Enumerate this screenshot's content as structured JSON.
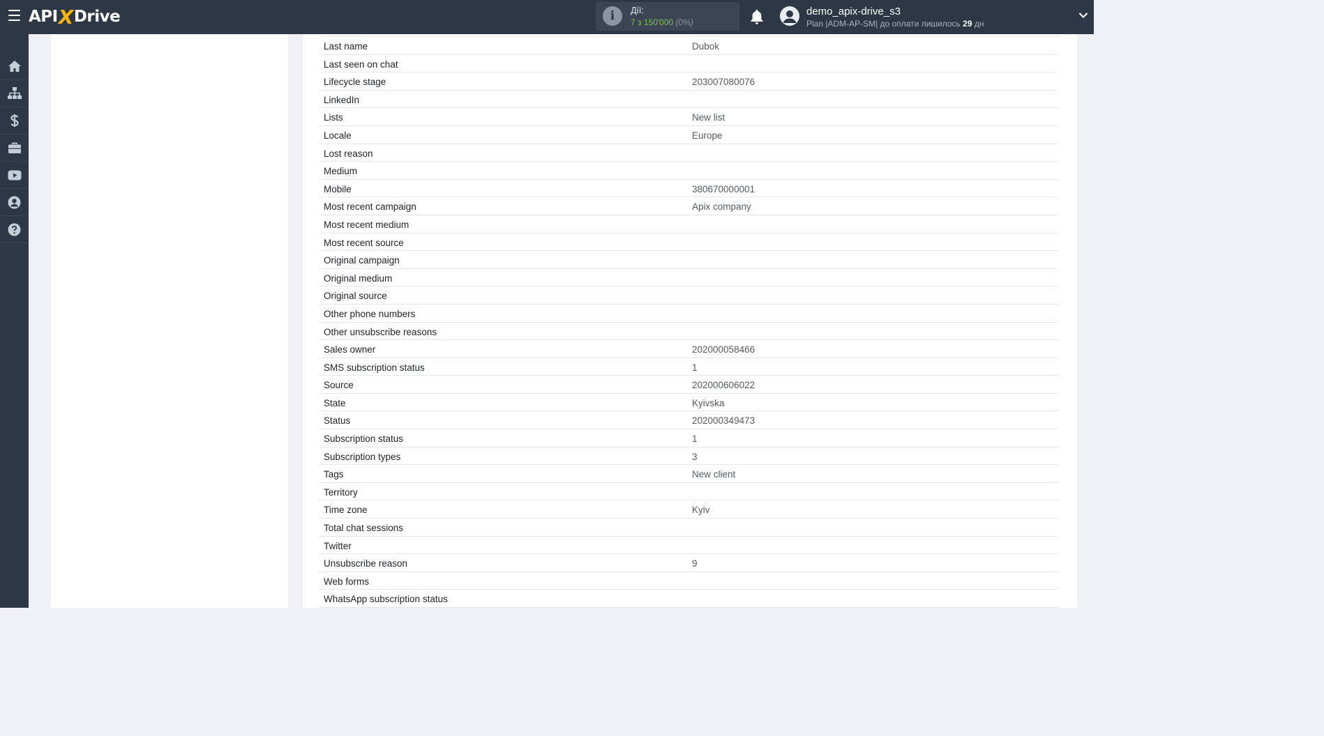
{
  "header": {
    "logo": {
      "part1": "API",
      "part2": "X",
      "part3": "Drive"
    },
    "actions": {
      "label": "Дії:",
      "value": "7 з 150'000",
      "percent": "(0%)"
    },
    "user": {
      "name": "demo_apix-drive_s3",
      "plan_prefix": "Plan |ADM-AP-SM| до оплати лишилось ",
      "days_value": "29",
      "days_suffix": " дн"
    }
  },
  "sidebar": {
    "items": [
      {
        "icon": "home-icon"
      },
      {
        "icon": "sitemap-icon"
      },
      {
        "icon": "dollar-icon"
      },
      {
        "icon": "briefcase-icon"
      },
      {
        "icon": "youtube-icon"
      },
      {
        "icon": "user-circle-icon"
      },
      {
        "icon": "help-icon"
      }
    ]
  },
  "fields": [
    {
      "name": "Last name",
      "value": "Dubok"
    },
    {
      "name": "Last seen on chat",
      "value": ""
    },
    {
      "name": "Lifecycle stage",
      "value": "203007080076"
    },
    {
      "name": "LinkedIn",
      "value": ""
    },
    {
      "name": "Lists",
      "value": "New list"
    },
    {
      "name": "Locale",
      "value": "Europe"
    },
    {
      "name": "Lost reason",
      "value": ""
    },
    {
      "name": "Medium",
      "value": ""
    },
    {
      "name": "Mobile",
      "value": "380670000001"
    },
    {
      "name": "Most recent campaign",
      "value": "Apix company"
    },
    {
      "name": "Most recent medium",
      "value": ""
    },
    {
      "name": "Most recent source",
      "value": ""
    },
    {
      "name": "Original campaign",
      "value": ""
    },
    {
      "name": "Original medium",
      "value": ""
    },
    {
      "name": "Original source",
      "value": ""
    },
    {
      "name": "Other phone numbers",
      "value": ""
    },
    {
      "name": "Other unsubscribe reasons",
      "value": ""
    },
    {
      "name": "Sales owner",
      "value": "202000058466"
    },
    {
      "name": "SMS subscription status",
      "value": "1"
    },
    {
      "name": "Source",
      "value": "202000606022"
    },
    {
      "name": "State",
      "value": "Kyivska"
    },
    {
      "name": "Status",
      "value": "202000349473"
    },
    {
      "name": "Subscription status",
      "value": "1"
    },
    {
      "name": "Subscription types",
      "value": "3"
    },
    {
      "name": "Tags",
      "value": "New client"
    },
    {
      "name": "Territory",
      "value": ""
    },
    {
      "name": "Time zone",
      "value": "Kyiv"
    },
    {
      "name": "Total chat sessions",
      "value": ""
    },
    {
      "name": "Twitter",
      "value": ""
    },
    {
      "name": "Unsubscribe reason",
      "value": "9"
    },
    {
      "name": "Web forms",
      "value": ""
    },
    {
      "name": "WhatsApp subscription status",
      "value": ""
    }
  ]
}
